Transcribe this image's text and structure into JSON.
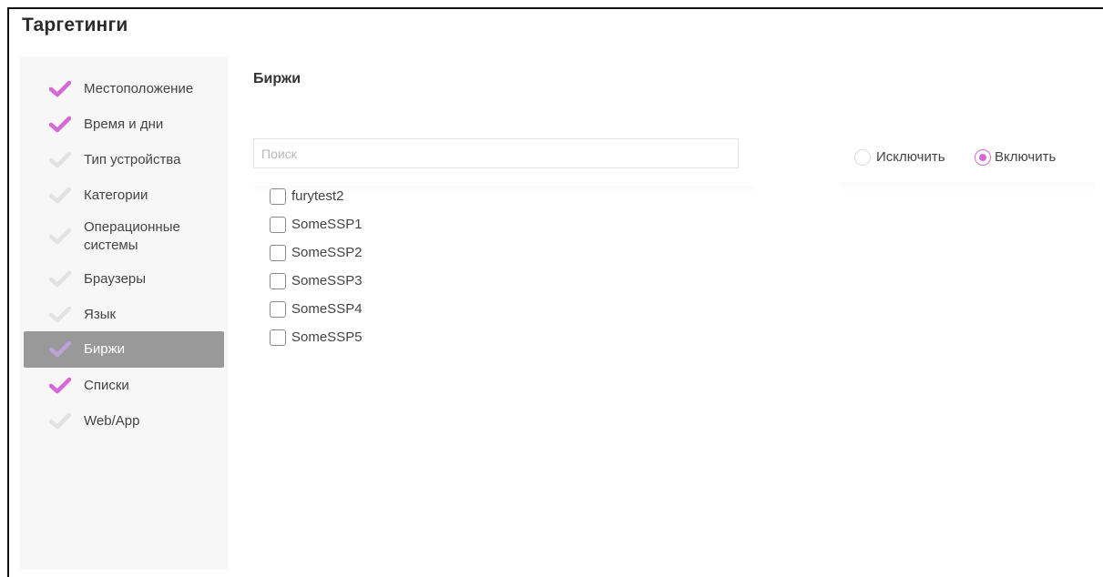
{
  "page": {
    "title": "Таргетинги"
  },
  "colors": {
    "accent": "#d56ad6",
    "check_inactive": "#e2e2e2",
    "active_item_bg": "#999999",
    "sidebar_bg": "#f7f7f7"
  },
  "sidebar": {
    "items": [
      {
        "label": "Местоположение",
        "checked": true,
        "icon": "checkmark-icon"
      },
      {
        "label": "Время и дни",
        "checked": true,
        "icon": "checkmark-icon"
      },
      {
        "label": "Тип устройства",
        "checked": false,
        "icon": "checkmark-icon"
      },
      {
        "label": "Категории",
        "checked": false,
        "icon": "checkmark-icon"
      },
      {
        "label": "Операционные системы",
        "checked": false,
        "icon": "checkmark-icon"
      },
      {
        "label": "Браузеры",
        "checked": false,
        "icon": "checkmark-icon"
      },
      {
        "label": "Язык",
        "checked": false,
        "icon": "checkmark-icon"
      },
      {
        "label": "Биржи",
        "checked": false,
        "active": true,
        "icon": "checkmark-icon"
      },
      {
        "label": "Списки",
        "checked": true,
        "icon": "checkmark-icon"
      },
      {
        "label": "Web/App",
        "checked": false,
        "icon": "checkmark-icon"
      }
    ]
  },
  "main": {
    "section_title": "Биржи",
    "search": {
      "placeholder": "Поиск",
      "value": ""
    },
    "mode": {
      "options": [
        {
          "label": "Исключить",
          "selected": false
        },
        {
          "label": "Включить",
          "selected": true
        }
      ]
    },
    "exchanges": [
      {
        "label": "furytest2",
        "checked": false
      },
      {
        "label": "SomeSSP1",
        "checked": false
      },
      {
        "label": "SomeSSP2",
        "checked": false
      },
      {
        "label": "SomeSSP3",
        "checked": false
      },
      {
        "label": "SomeSSP4",
        "checked": false
      },
      {
        "label": "SomeSSP5",
        "checked": false
      }
    ]
  }
}
